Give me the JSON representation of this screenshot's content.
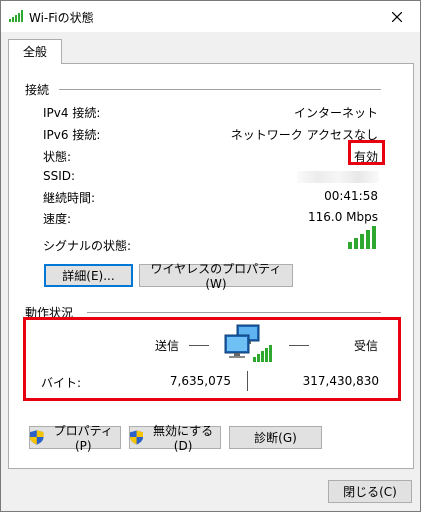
{
  "window": {
    "title": "Wi-Fiの状態"
  },
  "tabs": [
    {
      "label": "全般"
    }
  ],
  "connection": {
    "group_label": "接続",
    "ipv4_label": "IPv4 接続:",
    "ipv4_value": "インターネット",
    "ipv6_label": "IPv6 接続:",
    "ipv6_value": "ネットワーク アクセスなし",
    "state_label": "状態:",
    "state_value": "有効",
    "ssid_label": "SSID:",
    "ssid_value": "",
    "duration_label": "継続時間:",
    "duration_value": "00:41:58",
    "speed_label": "速度:",
    "speed_value": "116.0 Mbps",
    "signal_label": "シグナルの状態:",
    "signal_level": 5,
    "details_button": "詳細(E)...",
    "wireless_props_button": "ワイヤレスのプロパティ(W)"
  },
  "activity": {
    "group_label": "動作状況",
    "sent_label": "送信",
    "received_label": "受信",
    "bytes_label": "バイト:",
    "bytes_sent": "7,635,075",
    "bytes_received": "317,430,830"
  },
  "buttons": {
    "properties": "プロパティ(P)",
    "disable": "無効にする(D)",
    "diagnose": "診断(G)",
    "close": "閉じる(C)"
  },
  "colors": {
    "highlight": "#e60012",
    "signal": "#2fa82f"
  }
}
